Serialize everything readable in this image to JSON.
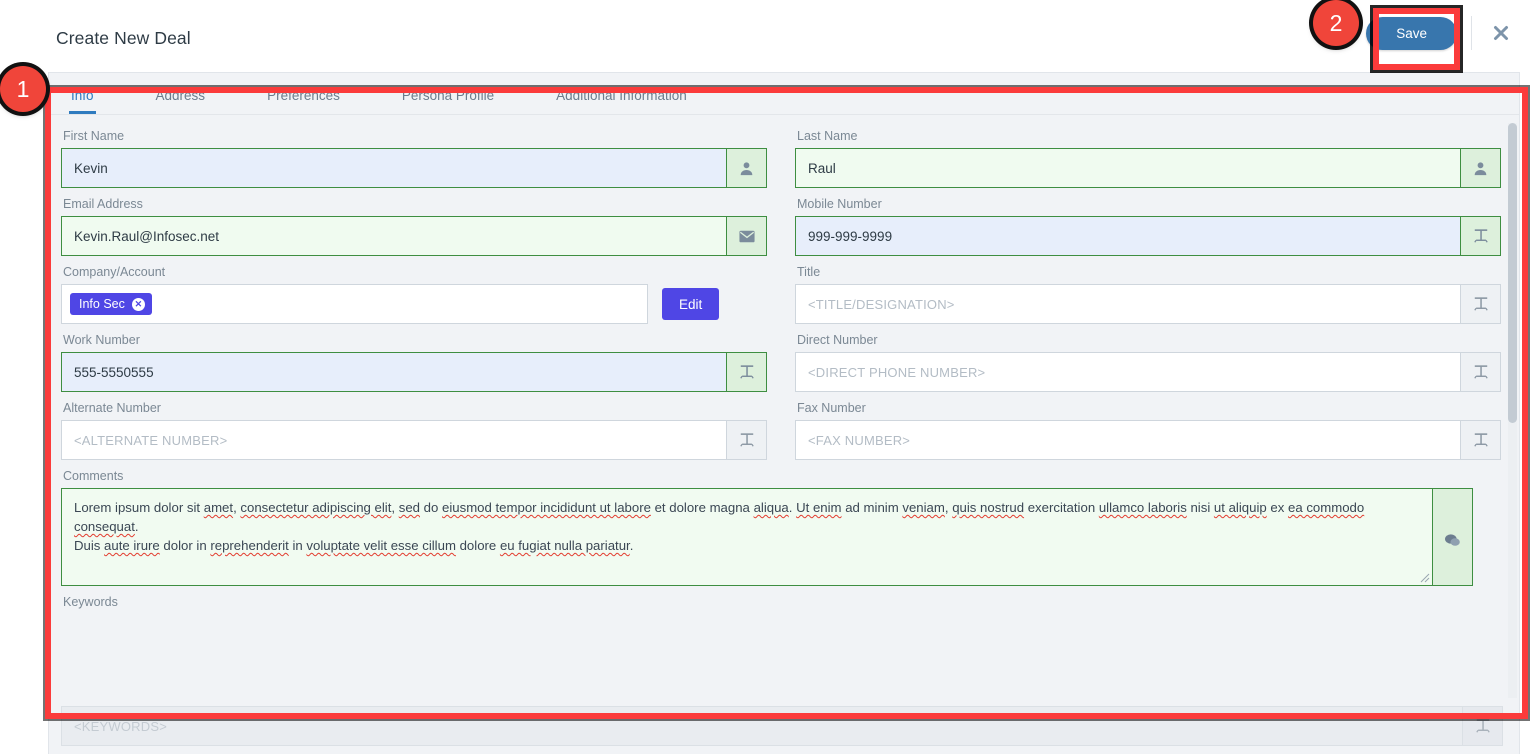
{
  "header": {
    "title": "Create New Deal",
    "save_label": "Save",
    "close_icon": "close-icon"
  },
  "tabs": [
    {
      "label": "Info",
      "active": true
    },
    {
      "label": "Address",
      "active": false
    },
    {
      "label": "Preferences",
      "active": false
    },
    {
      "label": "Persona Profile",
      "active": false
    },
    {
      "label": "Additional Information",
      "active": false
    }
  ],
  "fields": {
    "first_name": {
      "label": "First Name",
      "value": "Kevin",
      "placeholder": "",
      "icon": "person-icon",
      "state": "focused"
    },
    "last_name": {
      "label": "Last Name",
      "value": "Raul",
      "placeholder": "",
      "icon": "person-icon",
      "state": "valid"
    },
    "email": {
      "label": "Email Address",
      "value": "Kevin.Raul@Infosec.net",
      "placeholder": "",
      "icon": "envelope-icon",
      "state": "valid"
    },
    "mobile": {
      "label": "Mobile Number",
      "value": "999-999-9999",
      "placeholder": "",
      "icon": "text-format-icon",
      "state": "focused"
    },
    "company": {
      "label": "Company/Account",
      "chip": "Info Sec",
      "edit_label": "Edit"
    },
    "title": {
      "label": "Title",
      "value": "",
      "placeholder": "<TITLE/DESIGNATION>",
      "icon": "text-format-icon",
      "state": "empty"
    },
    "work_number": {
      "label": "Work Number",
      "value": "555-5550555",
      "placeholder": "",
      "icon": "text-format-icon",
      "state": "focused"
    },
    "direct_number": {
      "label": "Direct Number",
      "value": "",
      "placeholder": "<DIRECT PHONE NUMBER>",
      "icon": "text-format-icon",
      "state": "empty"
    },
    "alternate": {
      "label": "Alternate Number",
      "value": "",
      "placeholder": "<ALTERNATE NUMBER>",
      "icon": "text-format-icon",
      "state": "empty"
    },
    "fax": {
      "label": "Fax Number",
      "value": "",
      "placeholder": "<FAX NUMBER>",
      "icon": "text-format-icon",
      "state": "empty"
    },
    "comments": {
      "label": "Comments",
      "icon": "comment-bubble-icon",
      "line1_a": "Lorem ipsum dolor sit ",
      "line1_b": "amet",
      "line1_c": ", ",
      "line1_d": "consectetur adipiscing elit",
      "line1_e": ", ",
      "line1_f": "sed",
      "line1_g": " do ",
      "line1_h": "eiusmod tempor incididunt ut labore",
      "line1_i": " et dolore magna ",
      "line1_j": "aliqua",
      "line1_k": ". ",
      "line1_l": "Ut enim",
      "line1_m": " ad minim ",
      "line1_n": "veniam",
      "line1_o": ", ",
      "line1_p": "quis nostrud",
      "line1_q": " exercitation ",
      "line1_r": "ullamco laboris",
      "line1_s": " nisi ",
      "line1_t": "ut aliquip",
      "line1_u": " ex ",
      "line1_v": "ea commodo consequat",
      "line1_w": ".",
      "line2_a": "Duis ",
      "line2_b": "aute irure",
      "line2_c": " dolor in ",
      "line2_d": "reprehenderit",
      "line2_e": " in ",
      "line2_f": "voluptate velit esse cillum",
      "line2_g": " dolore ",
      "line2_h": "eu fugiat nulla pariatur",
      "line2_i": "."
    },
    "keywords": {
      "label": "Keywords",
      "value": "",
      "placeholder": "<KEYWORDS>",
      "icon": "text-format-icon",
      "state": "disabled"
    }
  },
  "annotations": [
    {
      "number": "1",
      "target": "form-panel"
    },
    {
      "number": "2",
      "target": "save-button"
    }
  ],
  "colors": {
    "accent_blue": "#3876ad",
    "tab_active": "#2f7bbf",
    "chip_indigo": "#4f46e5",
    "valid_green": "#3e8e41",
    "annotation_red": "#fb3b3b",
    "badge_red": "#f0453a"
  }
}
